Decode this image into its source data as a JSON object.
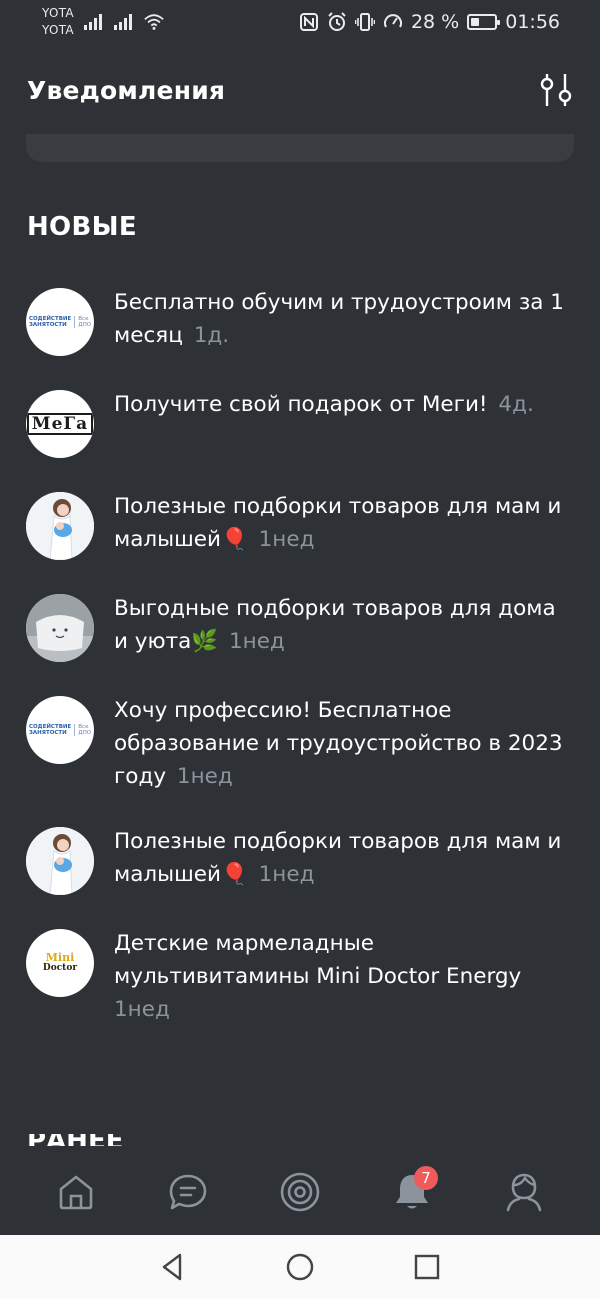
{
  "status_bar": {
    "carrier_1": "YOTA",
    "carrier_2": "YOTA",
    "battery_text": "28 %",
    "battery_level": 0.28,
    "time": "01:56",
    "icons": [
      "signal-icon",
      "signal-icon",
      "wifi-icon",
      "nfc-icon",
      "alarm-icon",
      "vibrate-icon",
      "speed-icon",
      "battery-icon"
    ]
  },
  "header": {
    "title": "Уведомления",
    "filter_icon": "filter-sliders-icon"
  },
  "section_new": {
    "title": "НОВЫЕ"
  },
  "section_earlier": {
    "title": "РАНЕЕ"
  },
  "notifications": [
    {
      "avatar": "szn-logo",
      "text": "Бесплатно обучим и трудоустроим за 1 месяц",
      "time": "1д."
    },
    {
      "avatar": "mega-logo",
      "text": "Получите свой подарок от Меги!",
      "time": "4д."
    },
    {
      "avatar": "mom-baby",
      "text": "Полезные подборки товаров для мам и малышей🎈",
      "time": "1нед"
    },
    {
      "avatar": "pillow",
      "text": "Выгодные подборки товаров для дома и уюта🌿",
      "time": "1нед"
    },
    {
      "avatar": "szn-logo",
      "text": "Хочу профессию! Бесплатное образование и трудоустройство в 2023 году",
      "time": "1нед"
    },
    {
      "avatar": "mom-baby",
      "text": "Полезные подборки товаров для мам и малышей🎈",
      "time": "1нед"
    },
    {
      "avatar": "mini-doctor-logo",
      "text": "Детские мармеладные мультивитамины Mini Doctor Energy",
      "time": "1нед"
    }
  ],
  "avatar_logos": {
    "szn_line1": "СОДЕЙСТВИЕ\nЗАНЯТОСТИ",
    "szn_line2": "Все\nДПО",
    "mega": "MeГa",
    "mini_doctor_top": "Mini",
    "mini_doctor_bottom": "Doctor"
  },
  "bottom_nav": {
    "items": [
      "home-icon",
      "messages-icon",
      "discover-icon",
      "notifications-bell-icon",
      "profile-icon"
    ],
    "notifications_badge": "7"
  },
  "system_nav": [
    "back-icon",
    "home-circle-icon",
    "recents-square-icon"
  ],
  "colors": {
    "background": "#2e3236",
    "card": "#393d42",
    "time_gray": "#8b939c",
    "badge": "#f05a5a"
  }
}
